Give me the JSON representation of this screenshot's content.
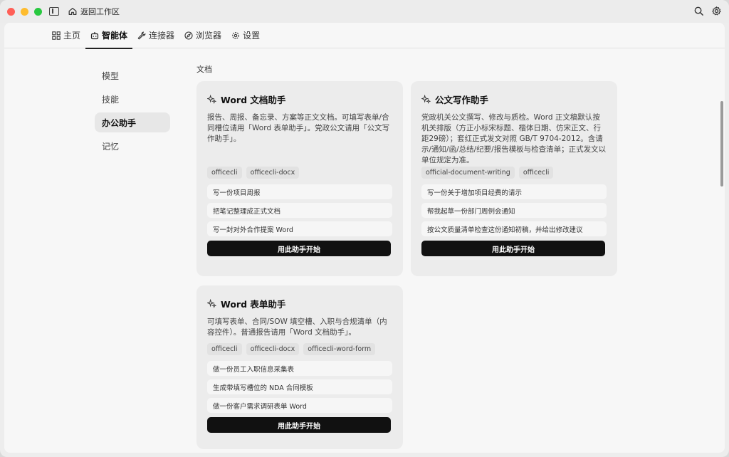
{
  "titlebar": {
    "back_label": "返回工作区"
  },
  "nav": {
    "items": [
      {
        "label": "主页",
        "icon": "grid-icon"
      },
      {
        "label": "智能体",
        "icon": "robot-icon"
      },
      {
        "label": "连接器",
        "icon": "wrench-icon"
      },
      {
        "label": "浏览器",
        "icon": "compass-icon"
      },
      {
        "label": "设置",
        "icon": "gear-icon"
      }
    ],
    "active": "智能体"
  },
  "menu": {
    "items": [
      "模型",
      "技能",
      "办公助手",
      "记忆"
    ],
    "active": "办公助手"
  },
  "section": {
    "title": "文档"
  },
  "cards": [
    {
      "title": "Word 文档助手",
      "desc": "报告、周报、备忘录、方案等正文文档。可填写表单/合同槽位请用「Word 表单助手」。党政公文请用「公文写作助手」。",
      "tags": [
        "officecli",
        "officecli-docx"
      ],
      "examples": [
        "写一份项目周报",
        "把笔记整理成正式文档",
        "写一封对外合作提案 Word"
      ],
      "button": "用此助手开始"
    },
    {
      "title": "公文写作助手",
      "desc": "党政机关公文撰写、修改与质检。Word 正文稿默认按机关排版（方正小标宋标题、楷体日期、仿宋正文、行距29磅）；套红正式发文对照 GB/T 9704-2012。含请示/通知/函/总结/纪要/报告模板与检查清单；正式发文以单位规定为准。",
      "tags": [
        "official-document-writing",
        "officecli"
      ],
      "examples": [
        "写一份关于增加项目经费的请示",
        "帮我起草一份部门周例会通知",
        "按公文质量清单检查这份通知初稿，并给出修改建议"
      ],
      "button": "用此助手开始"
    },
    {
      "title": "Word 表单助手",
      "desc": "可填写表单、合同/SOW 填空槽、入职与合规清单（内容控件）。普通报告请用「Word 文档助手」。",
      "tags": [
        "officecli",
        "officecli-docx",
        "officecli-word-form"
      ],
      "examples": [
        "做一份员工入职信息采集表",
        "生成带填写槽位的 NDA 合同模板",
        "做一份客户需求调研表单 Word"
      ],
      "button": "用此助手开始"
    }
  ]
}
